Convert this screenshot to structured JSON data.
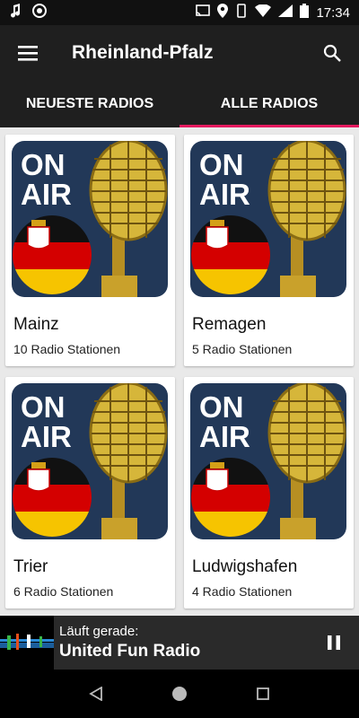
{
  "status_bar": {
    "time": "17:34"
  },
  "app_bar": {
    "title": "Rheinland-Pfalz"
  },
  "tabs": [
    {
      "label": "NEUESTE RADIOS"
    },
    {
      "label": "ALLE RADIOS"
    }
  ],
  "cards": [
    {
      "name": "Mainz",
      "subtitle": "10 Radio Stationen",
      "logo_text_1": "ON",
      "logo_text_2": "AIR"
    },
    {
      "name": "Remagen",
      "subtitle": "5 Radio Stationen",
      "logo_text_1": "ON",
      "logo_text_2": "AIR"
    },
    {
      "name": "Trier",
      "subtitle": "6 Radio Stationen",
      "logo_text_1": "ON",
      "logo_text_2": "AIR"
    },
    {
      "name": "Ludwigshafen",
      "subtitle": "4 Radio Stationen",
      "logo_text_1": "ON",
      "logo_text_2": "AIR"
    }
  ],
  "player": {
    "label": "Läuft gerade:",
    "station": "United Fun Radio"
  },
  "colors": {
    "accent": "#e5195f",
    "app_bar": "#1f1f1f",
    "card_art": "#223858"
  }
}
